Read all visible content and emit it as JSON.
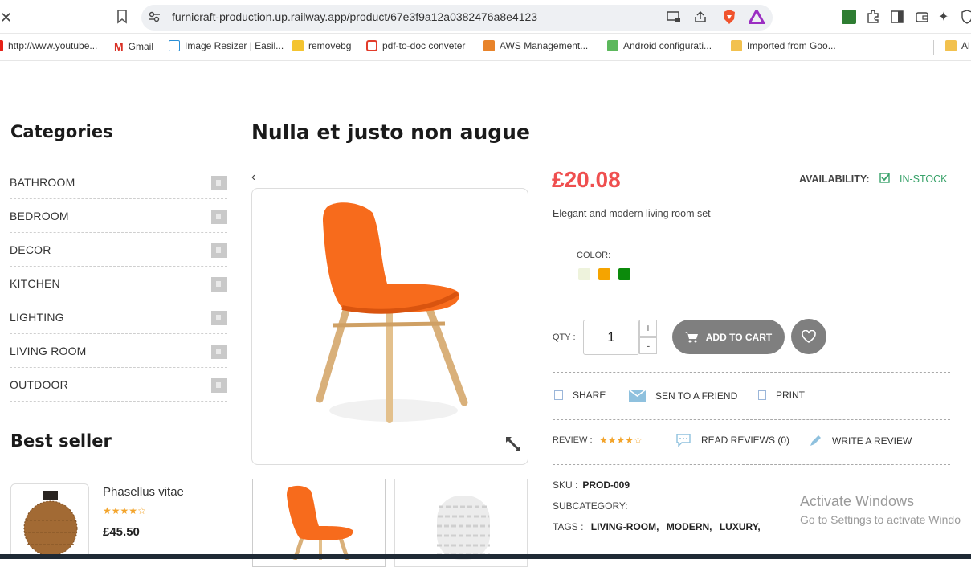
{
  "browser": {
    "url": "furnicraft-production.up.railway.app/product/67e3f9a12a0382476a8e4123",
    "bookmarks": [
      "http://www.youtube...",
      "Gmail",
      "Image Resizer | Easil...",
      "removebg",
      "pdf-to-doc conveter",
      "AWS Management...",
      "Android configurati...",
      "Imported from Goo...",
      "Al"
    ]
  },
  "sidebar": {
    "categories_title": "Categories",
    "categories": [
      "BATHROOM",
      "BEDROOM",
      "DECOR",
      "KITCHEN",
      "LIGHTING",
      "LIVING ROOM",
      "OUTDOOR"
    ],
    "best_seller_title": "Best seller",
    "best_seller": {
      "name": "Phasellus vitae",
      "price": "£45.50",
      "rating": 4
    }
  },
  "product": {
    "title": "Nulla et justo non augue",
    "prev_arrow": "‹",
    "price": "£20.08",
    "availability_label": "AVAILABILITY:",
    "availability_value": "IN-STOCK",
    "description": "Elegant and modern living room set",
    "color_label": "COLOR:",
    "colors": [
      "#eef3dc",
      "#f5a400",
      "#0b8a0b"
    ],
    "qty_label": "QTY :",
    "qty_value": "1",
    "qty_plus": "+",
    "qty_minus": "-",
    "add_to_cart": "ADD TO CART",
    "share": "SHARE",
    "send_friend": "SEN TO A FRIEND",
    "print": "PRINT",
    "review_label": "REVIEW :",
    "rating": 4,
    "read_reviews": "READ REVIEWS (0)",
    "write_review": "WRITE A REVIEW",
    "sku_label": "SKU :",
    "sku": "PROD-009",
    "subcategory_label": "SUBCATEGORY:",
    "tags_label": "TAGS :",
    "tags": [
      "LIVING-ROOM,",
      "MODERN,",
      "LUXURY,"
    ]
  },
  "overlay": {
    "activate_title": "Activate Windows",
    "activate_sub": "Go to Settings to activate Windo"
  }
}
